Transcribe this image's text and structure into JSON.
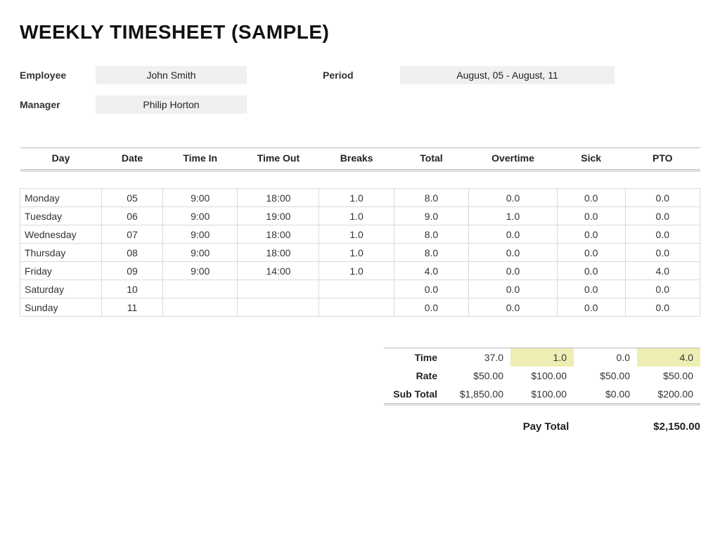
{
  "title": "WEEKLY TIMESHEET (SAMPLE)",
  "meta": {
    "employee_label": "Employee",
    "employee_value": "John Smith",
    "period_label": "Period",
    "period_value": "August, 05 - August, 11",
    "manager_label": "Manager",
    "manager_value": "Philip Horton"
  },
  "columns": {
    "day": "Day",
    "date": "Date",
    "time_in": "Time In",
    "time_out": "Time Out",
    "breaks": "Breaks",
    "total": "Total",
    "overtime": "Overtime",
    "sick": "Sick",
    "pto": "PTO"
  },
  "rows": [
    {
      "day": "Monday",
      "date": "05",
      "in": "9:00",
      "out": "18:00",
      "breaks": "1.0",
      "total": "8.0",
      "overtime": "0.0",
      "sick": "0.0",
      "pto": "0.0"
    },
    {
      "day": "Tuesday",
      "date": "06",
      "in": "9:00",
      "out": "19:00",
      "breaks": "1.0",
      "total": "9.0",
      "overtime": "1.0",
      "sick": "0.0",
      "pto": "0.0"
    },
    {
      "day": "Wednesday",
      "date": "07",
      "in": "9:00",
      "out": "18:00",
      "breaks": "1.0",
      "total": "8.0",
      "overtime": "0.0",
      "sick": "0.0",
      "pto": "0.0"
    },
    {
      "day": "Thursday",
      "date": "08",
      "in": "9:00",
      "out": "18:00",
      "breaks": "1.0",
      "total": "8.0",
      "overtime": "0.0",
      "sick": "0.0",
      "pto": "0.0"
    },
    {
      "day": "Friday",
      "date": "09",
      "in": "9:00",
      "out": "14:00",
      "breaks": "1.0",
      "total": "4.0",
      "overtime": "0.0",
      "sick": "0.0",
      "pto": "4.0"
    },
    {
      "day": "Saturday",
      "date": "10",
      "in": "",
      "out": "",
      "breaks": "",
      "total": "0.0",
      "overtime": "0.0",
      "sick": "0.0",
      "pto": "0.0"
    },
    {
      "day": "Sunday",
      "date": "11",
      "in": "",
      "out": "",
      "breaks": "",
      "total": "0.0",
      "overtime": "0.0",
      "sick": "0.0",
      "pto": "0.0"
    }
  ],
  "summary": {
    "time_label": "Time",
    "rate_label": "Rate",
    "subtotal_label": "Sub Total",
    "time": {
      "total": "37.0",
      "overtime": "1.0",
      "sick": "0.0",
      "pto": "4.0"
    },
    "rate": {
      "total": "$50.00",
      "overtime": "$100.00",
      "sick": "$50.00",
      "pto": "$50.00"
    },
    "subtotal": {
      "total": "$1,850.00",
      "overtime": "$100.00",
      "sick": "$0.00",
      "pto": "$200.00"
    }
  },
  "paytotal": {
    "label": "Pay Total",
    "value": "$2,150.00"
  }
}
